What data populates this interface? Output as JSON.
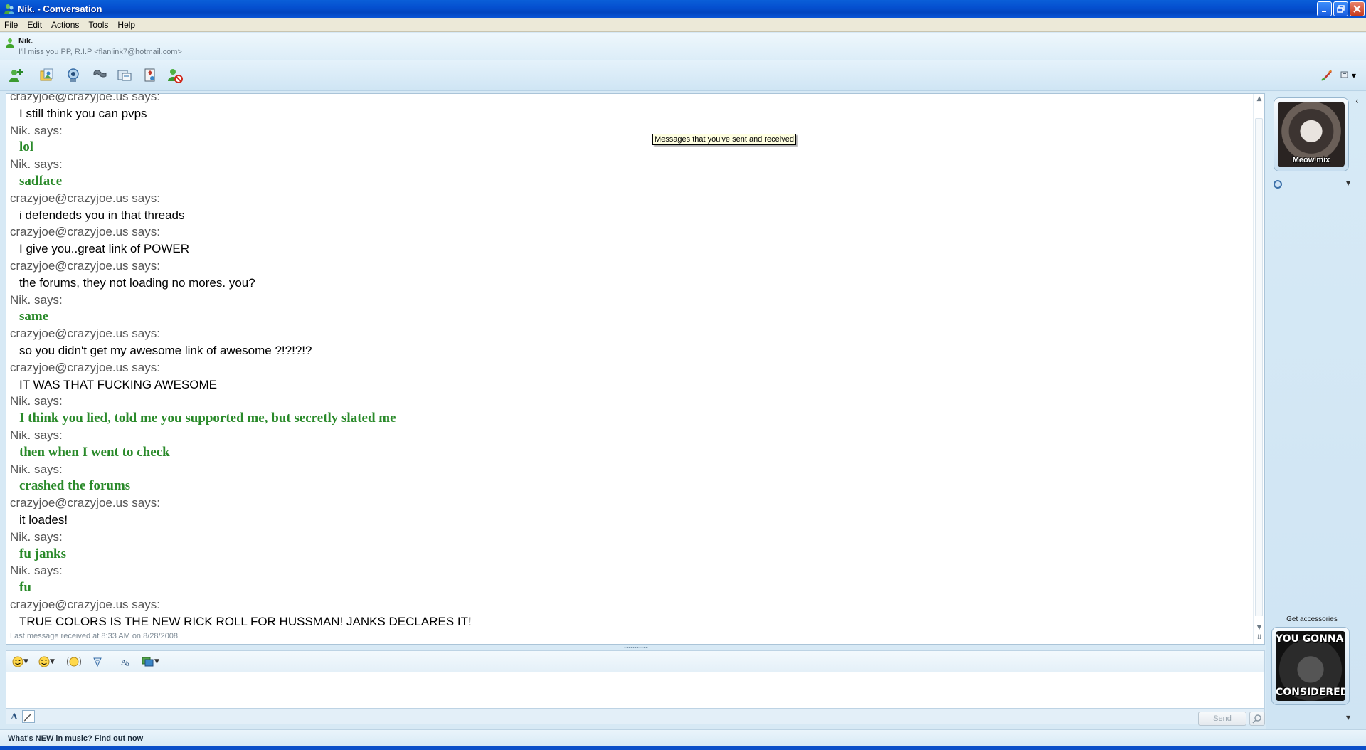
{
  "window": {
    "title": "Nik. - Conversation"
  },
  "menu": [
    "File",
    "Edit",
    "Actions",
    "Tools",
    "Help"
  ],
  "contact": {
    "name": "Nik.",
    "status": "I'll miss you PP, R.I.P <flanlink7@hotmail.com>"
  },
  "toolbar": {
    "icons": [
      "invite-contact-icon",
      "send-files-icon",
      "video-call-icon",
      "call-icon",
      "activities-icon",
      "games-icon",
      "block-contact-icon"
    ],
    "right_icons": [
      "theme-paint-icon",
      "menu-options-icon"
    ]
  },
  "history": {
    "tooltip": "Messages that you've sent and received",
    "last_message": "Last message received at 8:33 AM on 8/28/2008.",
    "messages": [
      {
        "sender": "crazyjoe@crazyjoe.us says:",
        "text": "I still think you can pvps",
        "style": "a"
      },
      {
        "sender": "Nik. says:",
        "text": "lol",
        "style": "b"
      },
      {
        "sender": "Nik. says:",
        "text": "sadface",
        "style": "b"
      },
      {
        "sender": "crazyjoe@crazyjoe.us says:",
        "text": "i defendeds you in that threads",
        "style": "a"
      },
      {
        "sender": "crazyjoe@crazyjoe.us says:",
        "text": "I give you..great link of POWER",
        "style": "a"
      },
      {
        "sender": "crazyjoe@crazyjoe.us says:",
        "text": "the forums, they not loading no mores. you?",
        "style": "a"
      },
      {
        "sender": "Nik. says:",
        "text": "same",
        "style": "b"
      },
      {
        "sender": "crazyjoe@crazyjoe.us says:",
        "text": "so you didn't get my awesome link of awesome ?!?!?!?",
        "style": "a"
      },
      {
        "sender": "crazyjoe@crazyjoe.us says:",
        "text": "IT WAS THAT FUCKING AWESOME",
        "style": "a"
      },
      {
        "sender": "Nik. says:",
        "text": "I think you lied, told me you supported me, but secretly slated me",
        "style": "b"
      },
      {
        "sender": "Nik. says:",
        "text": "then when I went to check",
        "style": "b"
      },
      {
        "sender": "Nik. says:",
        "text": "crashed the forums",
        "style": "b"
      },
      {
        "sender": "crazyjoe@crazyjoe.us says:",
        "text": "it loades!",
        "style": "a"
      },
      {
        "sender": "Nik. says:",
        "text": "fu janks",
        "style": "b"
      },
      {
        "sender": "Nik. says:",
        "text": "fu",
        "style": "b"
      },
      {
        "sender": "crazyjoe@crazyjoe.us says:",
        "text": "TRUE  COLORS IS THE NEW RICK ROLL FOR HUSSMAN! JANKS DECLARES IT!",
        "style": "a"
      }
    ]
  },
  "compose": {
    "value": "",
    "send_label": "Send"
  },
  "side_panel": {
    "contact_picture_caption": "Meow mix",
    "get_accessories": "Get accessories",
    "my_picture_top": "YOU GONNA GET",
    "my_picture_bottom": "CONSIDERED"
  },
  "status_bar": {
    "link": "What's NEW in music? Find out now"
  },
  "colors": {
    "crazyjoe_text": "#000000",
    "nik_text": "#2a8a2a",
    "sender_header": "#555555"
  }
}
